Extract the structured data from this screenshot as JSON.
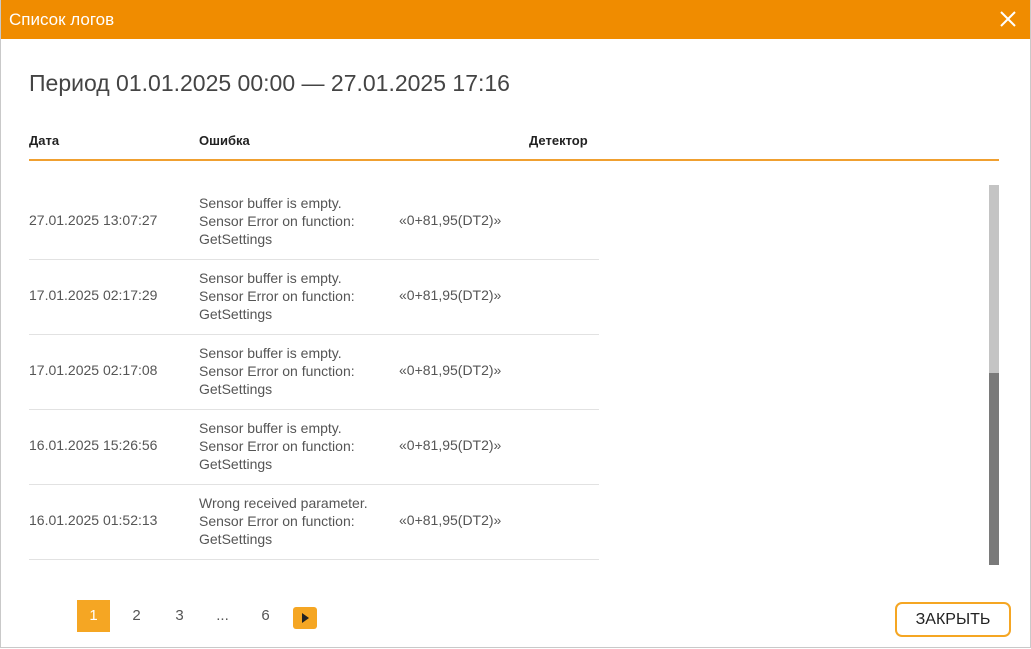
{
  "dialog": {
    "title": "Список логов",
    "close_icon": "close-icon"
  },
  "period": "Период 01.01.2025 00:00 — 27.01.2025 17:16",
  "table": {
    "headers": {
      "date": "Дата",
      "error": "Ошибка",
      "detector": "Детектор"
    },
    "rows": [
      {
        "date": "27.01.2025 13:07:27",
        "error_l1": "Sensor buffer is empty.",
        "error_l2": "Sensor Error on function:",
        "error_l3": "GetSettings",
        "detector": "«0+81,95(DT2)»"
      },
      {
        "date": "17.01.2025 02:17:29",
        "error_l1": "Sensor buffer is empty.",
        "error_l2": "Sensor Error on function:",
        "error_l3": "GetSettings",
        "detector": "«0+81,95(DT2)»"
      },
      {
        "date": "17.01.2025 02:17:08",
        "error_l1": "Sensor buffer is empty.",
        "error_l2": "Sensor Error on function:",
        "error_l3": "GetSettings",
        "detector": "«0+81,95(DT2)»"
      },
      {
        "date": "16.01.2025 15:26:56",
        "error_l1": "Sensor buffer is empty.",
        "error_l2": "Sensor Error on function:",
        "error_l3": "GetSettings",
        "detector": "«0+81,95(DT2)»"
      },
      {
        "date": "16.01.2025 01:52:13",
        "error_l1": "Wrong received parameter.",
        "error_l2": "Sensor Error on function:",
        "error_l3": "GetSettings",
        "detector": "«0+81,95(DT2)»"
      }
    ]
  },
  "pagination": {
    "pages": [
      "1",
      "2",
      "3",
      "...",
      "6"
    ],
    "current": "1",
    "next_icon": "chevron-right-icon"
  },
  "footer": {
    "close_label": "ЗАКРЫТЬ"
  },
  "colors": {
    "accent": "#f08c00",
    "accent_light": "#f5a623",
    "scroll_thumb": "#7a7a7a"
  }
}
